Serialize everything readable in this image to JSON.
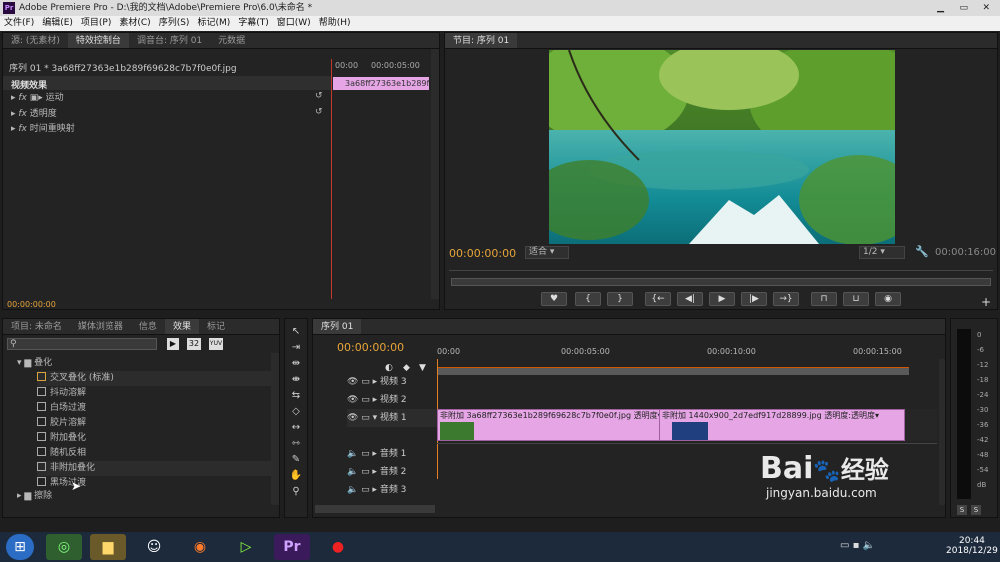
{
  "window": {
    "title": "Adobe Premiere Pro - D:\\我的文档\\Adobe\\Premiere Pro\\6.0\\未命名 *",
    "icon": "Pr"
  },
  "menu": [
    "文件(F)",
    "编辑(E)",
    "项目(P)",
    "素材(C)",
    "序列(S)",
    "标记(M)",
    "字幕(T)",
    "窗口(W)",
    "帮助(H)"
  ],
  "source_panel": {
    "tabs": [
      "源: (无素材)",
      "特效控制台",
      "调音台: 序列 01",
      "元数据"
    ],
    "clip_title": "序列 01 * 3a68ff27363e1b289f69628c7b7f0e0f.jpg",
    "ruler_start": "00:00",
    "ruler_mark": "00:00:05:00",
    "section": "视频效果",
    "effects": [
      "运动",
      "透明度",
      "时间重映射"
    ],
    "mini_clip": "3a68ff27363e1b289f69628c7b7f0e0f.jpg",
    "timecode": "00:00:00:00"
  },
  "program_panel": {
    "tab": "节目: 序列 01",
    "timecode": "00:00:00:00",
    "fit": "适合",
    "quality": "1/2",
    "duration": "00:00:16:00"
  },
  "effects_panel": {
    "tabs": [
      "项目: 未命名",
      "媒体浏览器",
      "信息",
      "效果",
      "标记"
    ],
    "badges": [
      "32",
      "YUV"
    ],
    "folder": "叠化",
    "items": [
      "交叉叠化 (标准)",
      "抖动溶解",
      "白场过渡",
      "胶片溶解",
      "附加叠化",
      "随机反相",
      "非附加叠化",
      "黑场过渡"
    ],
    "folder2": "擦除"
  },
  "timeline": {
    "tab": "序列 01",
    "timecode": "00:00:00:00",
    "ruler": [
      "00:00",
      "00:00:05:00",
      "00:00:10:00",
      "00:00:15:00"
    ],
    "tracks": [
      "视频 3",
      "视频 2",
      "视频 1",
      "音频 1",
      "音频 2",
      "音频 3"
    ],
    "clips": [
      {
        "label": "非附加",
        "name": "3a68ff27363e1b289f69628c7b7f0e0f.jpg",
        "prop": "透明度"
      },
      {
        "label": "非附加",
        "name": "1440x900_2d7edf917d28899.jpg",
        "prop": "透明度:透明度"
      }
    ]
  },
  "meter": {
    "scale": [
      "0",
      "-6",
      "-12",
      "-18",
      "-24",
      "-30",
      "-36",
      "-42",
      "-48",
      "-54",
      "dB"
    ],
    "solo": [
      "S",
      "S"
    ]
  },
  "taskbar": {
    "time": "20:44",
    "date": "2018/12/29"
  },
  "watermark": {
    "brand": "Bai",
    "brand2": "经验",
    "url": "jingyan.baidu.com"
  }
}
